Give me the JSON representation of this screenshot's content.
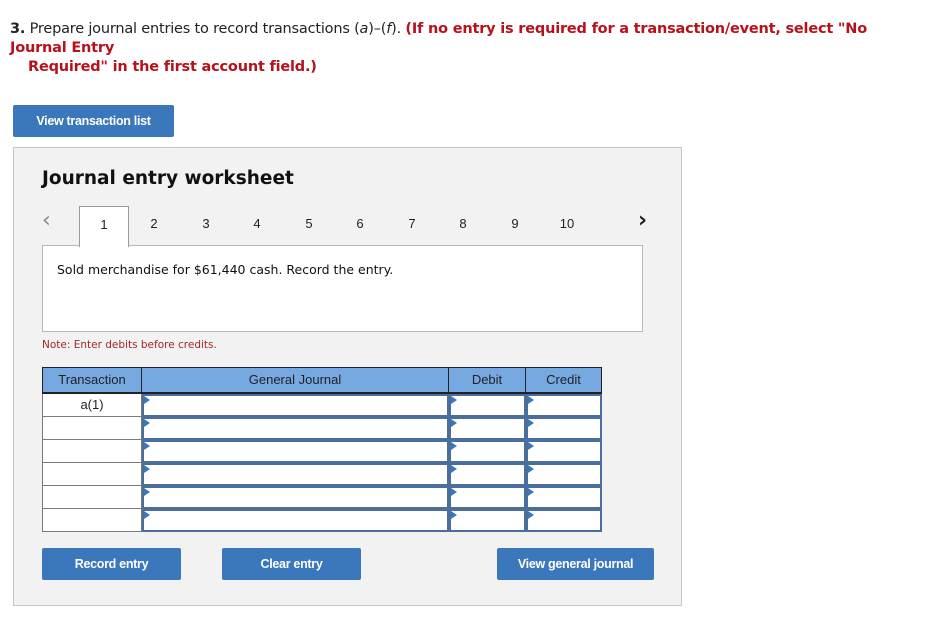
{
  "question": {
    "number": "3.",
    "text_prefix": "Prepare journal entries to record transactions (",
    "range_start": "a",
    "range_dash": ")–(",
    "range_end": "f",
    "text_suffix": ").",
    "instruction_line1": "(If no entry is required for a transaction/event, select \"No Journal Entry",
    "instruction_line2": "Required\" in the first account field.)"
  },
  "buttons": {
    "view_transaction_list": "View transaction list",
    "record_entry": "Record entry",
    "clear_entry": "Clear entry",
    "view_general_journal": "View general journal"
  },
  "worksheet": {
    "title": "Journal entry worksheet",
    "tabs": [
      "1",
      "2",
      "3",
      "4",
      "5",
      "6",
      "7",
      "8",
      "9",
      "10"
    ],
    "active_tab": "1",
    "prev_icon": "‹",
    "next_icon": "›",
    "prompt": "Sold merchandise for $61,440 cash. Record the entry.",
    "note": "Note: Enter debits before credits."
  },
  "journal": {
    "headers": {
      "transaction": "Transaction",
      "general_journal": "General Journal",
      "debit": "Debit",
      "credit": "Credit"
    },
    "rows": [
      {
        "transaction": "a(1)",
        "account": "",
        "debit": "",
        "credit": ""
      },
      {
        "transaction": "",
        "account": "",
        "debit": "",
        "credit": ""
      },
      {
        "transaction": "",
        "account": "",
        "debit": "",
        "credit": ""
      },
      {
        "transaction": "",
        "account": "",
        "debit": "",
        "credit": ""
      },
      {
        "transaction": "",
        "account": "",
        "debit": "",
        "credit": ""
      },
      {
        "transaction": "",
        "account": "",
        "debit": "",
        "credit": ""
      }
    ]
  },
  "colors": {
    "button_blue": "#3a77bb",
    "header_blue": "#76a9e2",
    "instruction_red": "#b5121b",
    "note_red": "#a5262b"
  }
}
